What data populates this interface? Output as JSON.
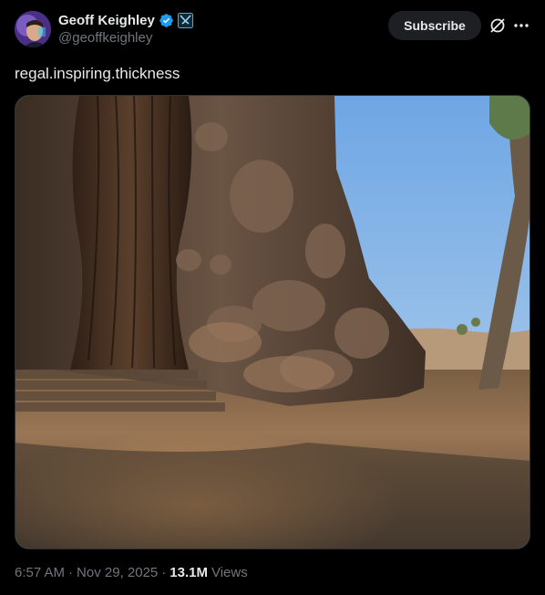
{
  "author": {
    "name": "Geoff Keighley",
    "handle": "@geoffkeighley",
    "verified": true,
    "affiliate_badge": "game-awards-badge-icon"
  },
  "actions": {
    "subscribe_label": "Subscribe",
    "grok_icon": "grok-icon",
    "more_icon": "more-options-icon"
  },
  "post": {
    "text": "regal.inspiring.thickness",
    "media_description_icon": "photo-image"
  },
  "meta": {
    "time": "6:57 AM",
    "separator": "·",
    "date": "Nov 29, 2025",
    "views_count": "13.1M",
    "views_label": "Views"
  },
  "colors": {
    "background": "#000000",
    "text_primary": "#e7e9ea",
    "text_secondary": "#71767b",
    "verified_blue": "#1d9bf0",
    "sky": "#7fb3e8"
  }
}
